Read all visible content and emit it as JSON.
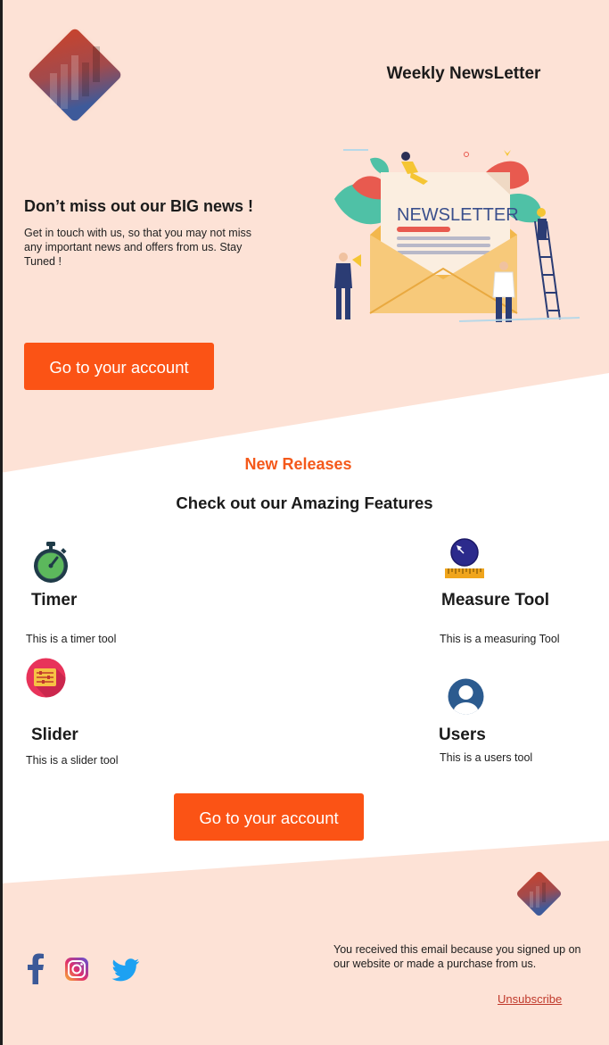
{
  "colors": {
    "peach": "#fde2d6",
    "accent": "#fb5315",
    "accent_text": "#f4591b",
    "unsubscribe": "#c0392b"
  },
  "header": {
    "title": "Weekly NewsLetter",
    "logo_icon": "diamond-chart-logo"
  },
  "hero": {
    "title": "Don’t miss out our BIG  news !",
    "text": "Get in touch with us, so that you may not miss any important news and offers from us. Stay Tuned !",
    "illustration_label": "NEWSLETTER",
    "cta": "Go to your account"
  },
  "releases": {
    "label": "New Releases",
    "title": "Check out our Amazing Features"
  },
  "features": [
    {
      "name": "Timer",
      "desc": "This is a timer tool",
      "icon": "stopwatch-icon"
    },
    {
      "name": "Measure Tool",
      "desc": "This is a measuring Tool",
      "icon": "measure-icon"
    },
    {
      "name": "Slider",
      "desc": "This is a slider tool",
      "icon": "slider-icon"
    },
    {
      "name": "Users",
      "desc": "This is a users tool",
      "icon": "user-icon"
    }
  ],
  "cta2": "Go to your account",
  "footer": {
    "social": [
      "facebook-icon",
      "instagram-icon",
      "twitter-icon"
    ],
    "text": "You received this email because you signed up on our website or made a purchase from us.",
    "unsubscribe": "Unsubscribe"
  }
}
